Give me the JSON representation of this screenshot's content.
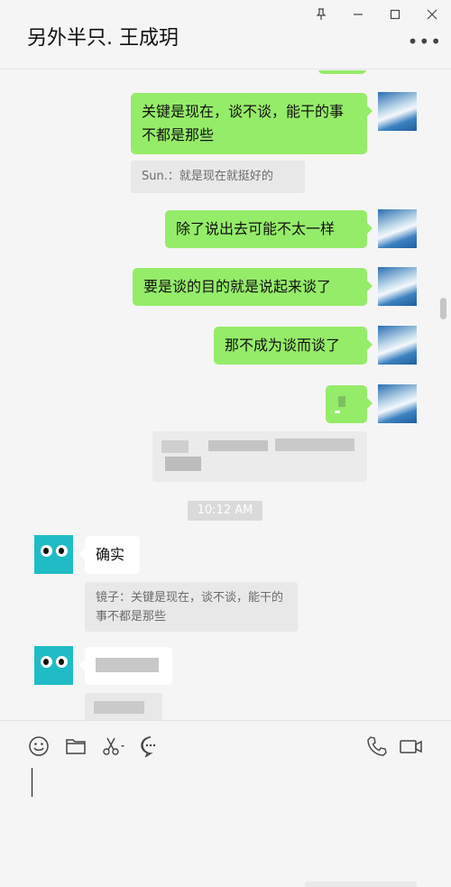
{
  "window": {
    "title": "另外半只. 王成玥"
  },
  "messages": {
    "m1": "关键是现在，谈不谈，能干的事不都是那些",
    "q1": "Sun.：就是现在就挺好的",
    "m2": "除了说出去可能不太一样",
    "m3": "要是谈的目的就是说起来谈了",
    "m4": "那不成为谈而谈了",
    "time": "10:12 AM",
    "m5": "确实",
    "q2": "镜子：关键是现在，谈不谈，能干的事不都是那些"
  },
  "icons": {
    "pin": "pin-icon",
    "minimize": "minimize-icon",
    "maximize": "maximize-icon",
    "close": "close-icon",
    "more": "more-icon",
    "emoji": "emoji-icon",
    "file": "folder-icon",
    "screenshot": "scissors-icon",
    "chat": "chat-bubble-icon",
    "call": "phone-icon",
    "video": "video-icon"
  },
  "colors": {
    "self_bubble": "#95ec69",
    "other_bubble": "#ffffff",
    "background": "#f5f5f5"
  }
}
